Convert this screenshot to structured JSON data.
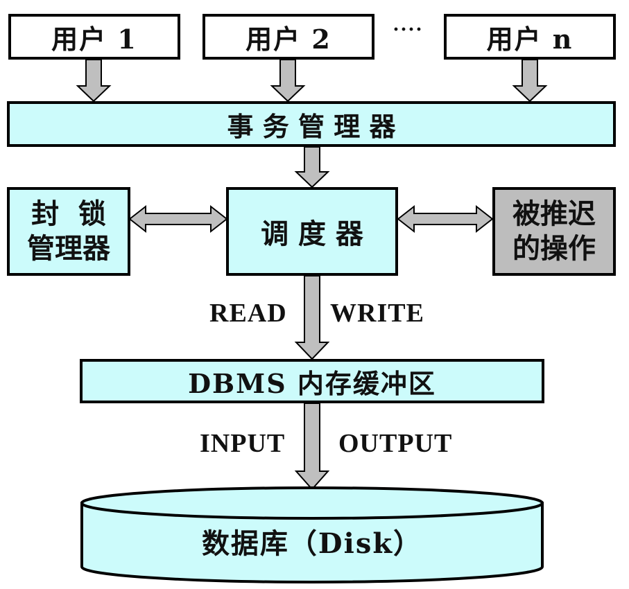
{
  "users": [
    "用户 1",
    "用户 2",
    "用户 n"
  ],
  "ellipsis": "····",
  "transaction_manager": "事 务 管 理 器",
  "lock_manager": [
    "封  锁",
    "管理器"
  ],
  "scheduler": "调 度 器",
  "delayed_ops": [
    "被推迟",
    "的操作"
  ],
  "read_label": "READ",
  "write_label": "WRITE",
  "buffer": "DBMS 内存缓冲区",
  "input_label": "INPUT",
  "output_label": "OUTPUT",
  "database": "数据库（Disk）",
  "colors": {
    "box_fill": "#ccfbfb",
    "delayed_fill": "#bdbdbd",
    "arrow_fill": "#bfbfbf",
    "stroke": "#000000"
  }
}
